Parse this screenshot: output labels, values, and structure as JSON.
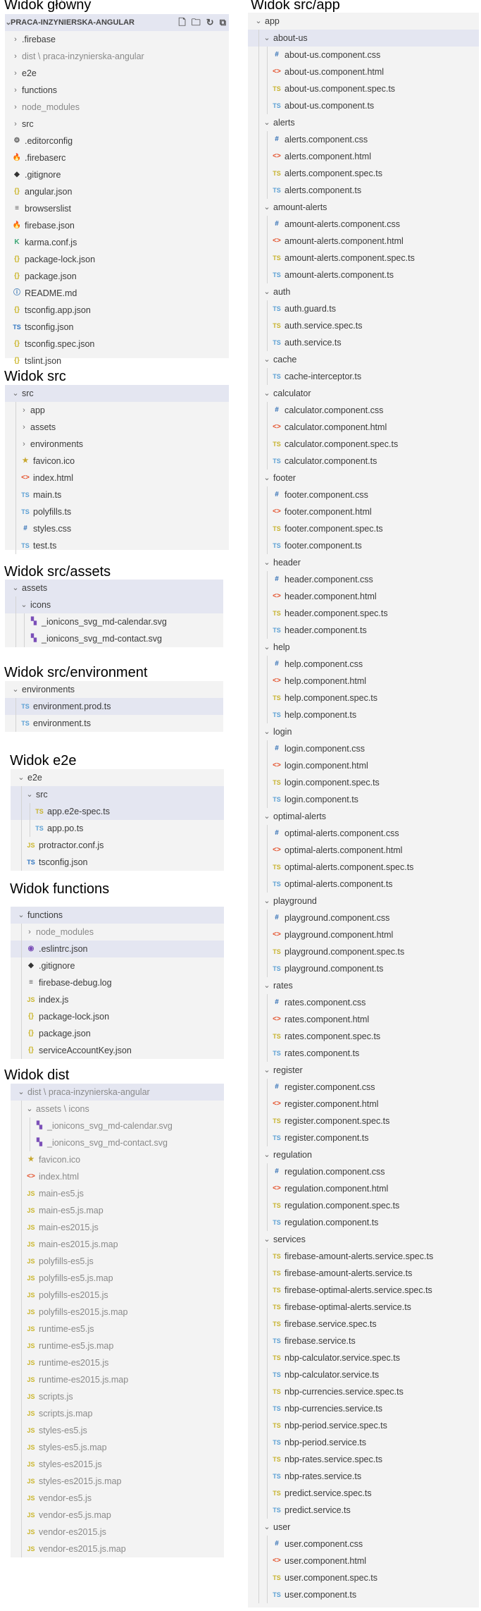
{
  "titles": {
    "main": "Widok główny",
    "app": "Widok src/app",
    "src": "Widok src",
    "assets": "Widok src/assets",
    "environment": "Widok src/environment",
    "e2e": "Widok e2e",
    "functions": "Widok functions",
    "dist": "Widok dist"
  },
  "main": {
    "header": "PRACA-INZYNIERSKA-ANGULAR",
    "rows": [
      {
        "d": 0,
        "t": "f",
        "l": ".firebase"
      },
      {
        "d": 0,
        "t": "f",
        "l": "dist",
        "extra": " \\ praca-inzynierska-angular",
        "dim": true
      },
      {
        "d": 0,
        "t": "f",
        "l": "e2e"
      },
      {
        "d": 0,
        "t": "f",
        "l": "functions"
      },
      {
        "d": 0,
        "t": "f",
        "l": "node_modules",
        "dim": true
      },
      {
        "d": 0,
        "t": "f",
        "l": "src"
      },
      {
        "d": 0,
        "t": "cfg",
        "l": ".editorconfig"
      },
      {
        "d": 0,
        "t": "fire",
        "l": ".firebaserc"
      },
      {
        "d": 0,
        "t": "git",
        "l": ".gitignore"
      },
      {
        "d": 0,
        "t": "json",
        "l": "angular.json"
      },
      {
        "d": 0,
        "t": "list",
        "l": "browserslist"
      },
      {
        "d": 0,
        "t": "fire",
        "l": "firebase.json"
      },
      {
        "d": 0,
        "t": "karma",
        "l": "karma.conf.js"
      },
      {
        "d": 0,
        "t": "json",
        "l": "package-lock.json"
      },
      {
        "d": 0,
        "t": "json",
        "l": "package.json"
      },
      {
        "d": 0,
        "t": "info",
        "l": "README.md"
      },
      {
        "d": 0,
        "t": "json",
        "l": "tsconfig.app.json"
      },
      {
        "d": 0,
        "t": "tsconf",
        "l": "tsconfig.json"
      },
      {
        "d": 0,
        "t": "json",
        "l": "tsconfig.spec.json"
      },
      {
        "d": 0,
        "t": "json",
        "l": "tslint.json"
      }
    ]
  },
  "src": {
    "rows": [
      {
        "d": 0,
        "t": "fo",
        "l": "src",
        "sel": true
      },
      {
        "d": 1,
        "t": "f",
        "l": "app"
      },
      {
        "d": 1,
        "t": "f",
        "l": "assets"
      },
      {
        "d": 1,
        "t": "f",
        "l": "environments"
      },
      {
        "d": 1,
        "t": "star",
        "l": "favicon.ico"
      },
      {
        "d": 1,
        "t": "html",
        "l": "index.html"
      },
      {
        "d": 1,
        "t": "ts",
        "l": "main.ts"
      },
      {
        "d": 1,
        "t": "ts",
        "l": "polyfills.ts"
      },
      {
        "d": 1,
        "t": "css",
        "l": "styles.css"
      },
      {
        "d": 1,
        "t": "ts",
        "l": "test.ts"
      }
    ]
  },
  "assets": {
    "rows": [
      {
        "d": 0,
        "t": "fo",
        "l": "assets",
        "sel": true
      },
      {
        "d": 1,
        "t": "fo",
        "l": "icons",
        "sel": true
      },
      {
        "d": 2,
        "t": "svg",
        "l": "_ionicons_svg_md-calendar.svg"
      },
      {
        "d": 2,
        "t": "svg",
        "l": "_ionicons_svg_md-contact.svg"
      }
    ]
  },
  "environment": {
    "rows": [
      {
        "d": 0,
        "t": "fo",
        "l": "environments"
      },
      {
        "d": 1,
        "t": "ts",
        "l": "environment.prod.ts",
        "sel": true
      },
      {
        "d": 1,
        "t": "ts",
        "l": "environment.ts"
      }
    ]
  },
  "e2e": {
    "rows": [
      {
        "d": 0,
        "t": "fo",
        "l": "e2e"
      },
      {
        "d": 1,
        "t": "fo",
        "l": "src",
        "sel": true
      },
      {
        "d": 2,
        "t": "tsspec",
        "l": "app.e2e-spec.ts",
        "sel": true
      },
      {
        "d": 2,
        "t": "ts",
        "l": "app.po.ts"
      },
      {
        "d": 1,
        "t": "js",
        "l": "protractor.conf.js"
      },
      {
        "d": 1,
        "t": "tsconf",
        "l": "tsconfig.json"
      }
    ]
  },
  "functions": {
    "rows": [
      {
        "d": 0,
        "t": "fo",
        "l": "functions",
        "sel": true
      },
      {
        "d": 1,
        "t": "f",
        "l": "node_modules",
        "dim": true
      },
      {
        "d": 1,
        "t": "eslint",
        "l": ".eslintrc.json",
        "sel": true
      },
      {
        "d": 1,
        "t": "git",
        "l": ".gitignore"
      },
      {
        "d": 1,
        "t": "list",
        "l": "firebase-debug.log"
      },
      {
        "d": 1,
        "t": "js",
        "l": "index.js"
      },
      {
        "d": 1,
        "t": "json",
        "l": "package-lock.json"
      },
      {
        "d": 1,
        "t": "json",
        "l": "package.json"
      },
      {
        "d": 1,
        "t": "json",
        "l": "serviceAccountKey.json"
      }
    ]
  },
  "dist": {
    "rows": [
      {
        "d": 0,
        "t": "fo",
        "l": "dist",
        "extra": " \\ praca-inzynierska-angular",
        "dim": true,
        "sel": true
      },
      {
        "d": 1,
        "t": "fo",
        "l": "assets",
        "extra": " \\ icons",
        "dim": true
      },
      {
        "d": 2,
        "t": "svg",
        "l": "_ionicons_svg_md-calendar.svg",
        "dim": true
      },
      {
        "d": 2,
        "t": "svg",
        "l": "_ionicons_svg_md-contact.svg",
        "dim": true
      },
      {
        "d": 1,
        "t": "star",
        "l": "favicon.ico",
        "dim": true
      },
      {
        "d": 1,
        "t": "html",
        "l": "index.html",
        "dim": true
      },
      {
        "d": 1,
        "t": "js",
        "l": "main-es5.js",
        "dim": true
      },
      {
        "d": 1,
        "t": "js",
        "l": "main-es5.js.map",
        "dim": true
      },
      {
        "d": 1,
        "t": "js",
        "l": "main-es2015.js",
        "dim": true
      },
      {
        "d": 1,
        "t": "js",
        "l": "main-es2015.js.map",
        "dim": true
      },
      {
        "d": 1,
        "t": "js",
        "l": "polyfills-es5.js",
        "dim": true
      },
      {
        "d": 1,
        "t": "js",
        "l": "polyfills-es5.js.map",
        "dim": true
      },
      {
        "d": 1,
        "t": "js",
        "l": "polyfills-es2015.js",
        "dim": true
      },
      {
        "d": 1,
        "t": "js",
        "l": "polyfills-es2015.js.map",
        "dim": true
      },
      {
        "d": 1,
        "t": "js",
        "l": "runtime-es5.js",
        "dim": true
      },
      {
        "d": 1,
        "t": "js",
        "l": "runtime-es5.js.map",
        "dim": true
      },
      {
        "d": 1,
        "t": "js",
        "l": "runtime-es2015.js",
        "dim": true
      },
      {
        "d": 1,
        "t": "js",
        "l": "runtime-es2015.js.map",
        "dim": true
      },
      {
        "d": 1,
        "t": "js",
        "l": "scripts.js",
        "dim": true
      },
      {
        "d": 1,
        "t": "js",
        "l": "scripts.js.map",
        "dim": true
      },
      {
        "d": 1,
        "t": "js",
        "l": "styles-es5.js",
        "dim": true
      },
      {
        "d": 1,
        "t": "js",
        "l": "styles-es5.js.map",
        "dim": true
      },
      {
        "d": 1,
        "t": "js",
        "l": "styles-es2015.js",
        "dim": true
      },
      {
        "d": 1,
        "t": "js",
        "l": "styles-es2015.js.map",
        "dim": true
      },
      {
        "d": 1,
        "t": "js",
        "l": "vendor-es5.js",
        "dim": true
      },
      {
        "d": 1,
        "t": "js",
        "l": "vendor-es5.js.map",
        "dim": true
      },
      {
        "d": 1,
        "t": "js",
        "l": "vendor-es2015.js",
        "dim": true
      },
      {
        "d": 1,
        "t": "js",
        "l": "vendor-es2015.js.map",
        "dim": true
      }
    ]
  },
  "app": {
    "rows": [
      {
        "d": 0,
        "t": "fo",
        "l": "app"
      },
      {
        "d": 1,
        "t": "fo",
        "l": "about-us",
        "sel": true
      },
      {
        "d": 2,
        "t": "css",
        "l": "about-us.component.css"
      },
      {
        "d": 2,
        "t": "html",
        "l": "about-us.component.html"
      },
      {
        "d": 2,
        "t": "tsspec",
        "l": "about-us.component.spec.ts"
      },
      {
        "d": 2,
        "t": "ts",
        "l": "about-us.component.ts"
      },
      {
        "d": 1,
        "t": "fo",
        "l": "alerts"
      },
      {
        "d": 2,
        "t": "css",
        "l": "alerts.component.css"
      },
      {
        "d": 2,
        "t": "html",
        "l": "alerts.component.html"
      },
      {
        "d": 2,
        "t": "tsspec",
        "l": "alerts.component.spec.ts"
      },
      {
        "d": 2,
        "t": "ts",
        "l": "alerts.component.ts"
      },
      {
        "d": 1,
        "t": "fo",
        "l": "amount-alerts"
      },
      {
        "d": 2,
        "t": "css",
        "l": "amount-alerts.component.css"
      },
      {
        "d": 2,
        "t": "html",
        "l": "amount-alerts.component.html"
      },
      {
        "d": 2,
        "t": "tsspec",
        "l": "amount-alerts.component.spec.ts"
      },
      {
        "d": 2,
        "t": "ts",
        "l": "amount-alerts.component.ts"
      },
      {
        "d": 1,
        "t": "fo",
        "l": "auth"
      },
      {
        "d": 2,
        "t": "ts",
        "l": "auth.guard.ts"
      },
      {
        "d": 2,
        "t": "tsspec",
        "l": "auth.service.spec.ts"
      },
      {
        "d": 2,
        "t": "ts",
        "l": "auth.service.ts"
      },
      {
        "d": 1,
        "t": "fo",
        "l": "cache"
      },
      {
        "d": 2,
        "t": "ts",
        "l": "cache-interceptor.ts"
      },
      {
        "d": 1,
        "t": "fo",
        "l": "calculator"
      },
      {
        "d": 2,
        "t": "css",
        "l": "calculator.component.css"
      },
      {
        "d": 2,
        "t": "html",
        "l": "calculator.component.html"
      },
      {
        "d": 2,
        "t": "tsspec",
        "l": "calculator.component.spec.ts"
      },
      {
        "d": 2,
        "t": "ts",
        "l": "calculator.component.ts"
      },
      {
        "d": 1,
        "t": "fo",
        "l": "footer"
      },
      {
        "d": 2,
        "t": "css",
        "l": "footer.component.css"
      },
      {
        "d": 2,
        "t": "html",
        "l": "footer.component.html"
      },
      {
        "d": 2,
        "t": "tsspec",
        "l": "footer.component.spec.ts"
      },
      {
        "d": 2,
        "t": "ts",
        "l": "footer.component.ts"
      },
      {
        "d": 1,
        "t": "fo",
        "l": "header"
      },
      {
        "d": 2,
        "t": "css",
        "l": "header.component.css"
      },
      {
        "d": 2,
        "t": "html",
        "l": "header.component.html"
      },
      {
        "d": 2,
        "t": "tsspec",
        "l": "header.component.spec.ts"
      },
      {
        "d": 2,
        "t": "ts",
        "l": "header.component.ts"
      },
      {
        "d": 1,
        "t": "fo",
        "l": "help"
      },
      {
        "d": 2,
        "t": "css",
        "l": "help.component.css"
      },
      {
        "d": 2,
        "t": "html",
        "l": "help.component.html"
      },
      {
        "d": 2,
        "t": "tsspec",
        "l": "help.component.spec.ts"
      },
      {
        "d": 2,
        "t": "ts",
        "l": "help.component.ts"
      },
      {
        "d": 1,
        "t": "fo",
        "l": "login"
      },
      {
        "d": 2,
        "t": "css",
        "l": "login.component.css"
      },
      {
        "d": 2,
        "t": "html",
        "l": "login.component.html"
      },
      {
        "d": 2,
        "t": "tsspec",
        "l": "login.component.spec.ts"
      },
      {
        "d": 2,
        "t": "ts",
        "l": "login.component.ts"
      },
      {
        "d": 1,
        "t": "fo",
        "l": "optimal-alerts"
      },
      {
        "d": 2,
        "t": "css",
        "l": "optimal-alerts.component.css"
      },
      {
        "d": 2,
        "t": "html",
        "l": "optimal-alerts.component.html"
      },
      {
        "d": 2,
        "t": "tsspec",
        "l": "optimal-alerts.component.spec.ts"
      },
      {
        "d": 2,
        "t": "ts",
        "l": "optimal-alerts.component.ts"
      },
      {
        "d": 1,
        "t": "fo",
        "l": "playground"
      },
      {
        "d": 2,
        "t": "css",
        "l": "playground.component.css"
      },
      {
        "d": 2,
        "t": "html",
        "l": "playground.component.html"
      },
      {
        "d": 2,
        "t": "tsspec",
        "l": "playground.component.spec.ts"
      },
      {
        "d": 2,
        "t": "ts",
        "l": "playground.component.ts"
      },
      {
        "d": 1,
        "t": "fo",
        "l": "rates"
      },
      {
        "d": 2,
        "t": "css",
        "l": "rates.component.css"
      },
      {
        "d": 2,
        "t": "html",
        "l": "rates.component.html"
      },
      {
        "d": 2,
        "t": "tsspec",
        "l": "rates.component.spec.ts"
      },
      {
        "d": 2,
        "t": "ts",
        "l": "rates.component.ts"
      },
      {
        "d": 1,
        "t": "fo",
        "l": "register"
      },
      {
        "d": 2,
        "t": "css",
        "l": "register.component.css"
      },
      {
        "d": 2,
        "t": "html",
        "l": "register.component.html"
      },
      {
        "d": 2,
        "t": "tsspec",
        "l": "register.component.spec.ts"
      },
      {
        "d": 2,
        "t": "ts",
        "l": "register.component.ts"
      },
      {
        "d": 1,
        "t": "fo",
        "l": "regulation"
      },
      {
        "d": 2,
        "t": "css",
        "l": "regulation.component.css"
      },
      {
        "d": 2,
        "t": "html",
        "l": "regulation.component.html"
      },
      {
        "d": 2,
        "t": "tsspec",
        "l": "regulation.component.spec.ts"
      },
      {
        "d": 2,
        "t": "ts",
        "l": "regulation.component.ts"
      },
      {
        "d": 1,
        "t": "fo",
        "l": "services"
      },
      {
        "d": 2,
        "t": "tsspec",
        "l": "firebase-amount-alerts.service.spec.ts"
      },
      {
        "d": 2,
        "t": "tsspec",
        "l": "firebase-amount-alerts.service.ts"
      },
      {
        "d": 2,
        "t": "tsspec",
        "l": "firebase-optimal-alerts.service.spec.ts"
      },
      {
        "d": 2,
        "t": "tsspec",
        "l": "firebase-optimal-alerts.service.ts"
      },
      {
        "d": 2,
        "t": "tsspec",
        "l": "firebase.service.spec.ts"
      },
      {
        "d": 2,
        "t": "ts",
        "l": "firebase.service.ts"
      },
      {
        "d": 2,
        "t": "tsspec",
        "l": "nbp-calculator.service.spec.ts"
      },
      {
        "d": 2,
        "t": "ts",
        "l": "nbp-calculator.service.ts"
      },
      {
        "d": 2,
        "t": "tsspec",
        "l": "nbp-currencies.service.spec.ts"
      },
      {
        "d": 2,
        "t": "ts",
        "l": "nbp-currencies.service.ts"
      },
      {
        "d": 2,
        "t": "tsspec",
        "l": "nbp-period.service.spec.ts"
      },
      {
        "d": 2,
        "t": "ts",
        "l": "nbp-period.service.ts"
      },
      {
        "d": 2,
        "t": "tsspec",
        "l": "nbp-rates.service.spec.ts"
      },
      {
        "d": 2,
        "t": "ts",
        "l": "nbp-rates.service.ts"
      },
      {
        "d": 2,
        "t": "tsspec",
        "l": "predict.service.spec.ts"
      },
      {
        "d": 2,
        "t": "ts",
        "l": "predict.service.ts"
      },
      {
        "d": 1,
        "t": "fo",
        "l": "user"
      },
      {
        "d": 2,
        "t": "css",
        "l": "user.component.css"
      },
      {
        "d": 2,
        "t": "html",
        "l": "user.component.html"
      },
      {
        "d": 2,
        "t": "tsspec",
        "l": "user.component.spec.ts"
      },
      {
        "d": 2,
        "t": "ts",
        "l": "user.component.ts"
      }
    ]
  }
}
